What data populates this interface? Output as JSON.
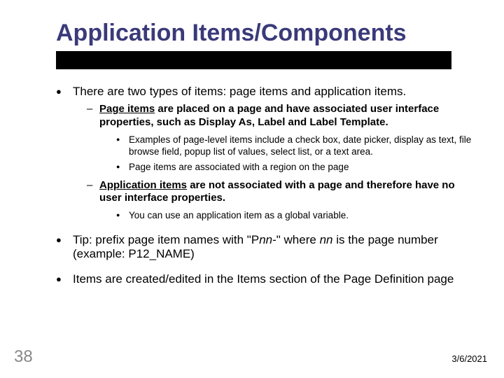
{
  "title": "Application Items/Components",
  "bullets": {
    "b1": {
      "text": "There are two types of items: page items and application items.",
      "sub1": {
        "lead_u": "Page items",
        "rest": " are placed on a page and have associated user interface properties, such as Display As, Label and Label Template.",
        "sub_a": "Examples of page-level items include a check box, date picker, display as text, file browse field, popup list of values, select list, or a text area.",
        "sub_b": "Page items are associated with a region on the page"
      },
      "sub2": {
        "lead_u": "Application items",
        "rest": " are not associated with a page and therefore have no user interface properties.",
        "sub_a": "You can use an application item as a global variable."
      }
    },
    "b2": {
      "pre": "Tip: prefix page item names with \"P",
      "nn1": "nn",
      "mid": "-\" where ",
      "nn2": "nn",
      "post": " is the page number (example:  P12_NAME)"
    },
    "b3": "Items are created/edited in the Items section of the Page Definition page"
  },
  "page_number": "38",
  "date": "3/6/2021"
}
